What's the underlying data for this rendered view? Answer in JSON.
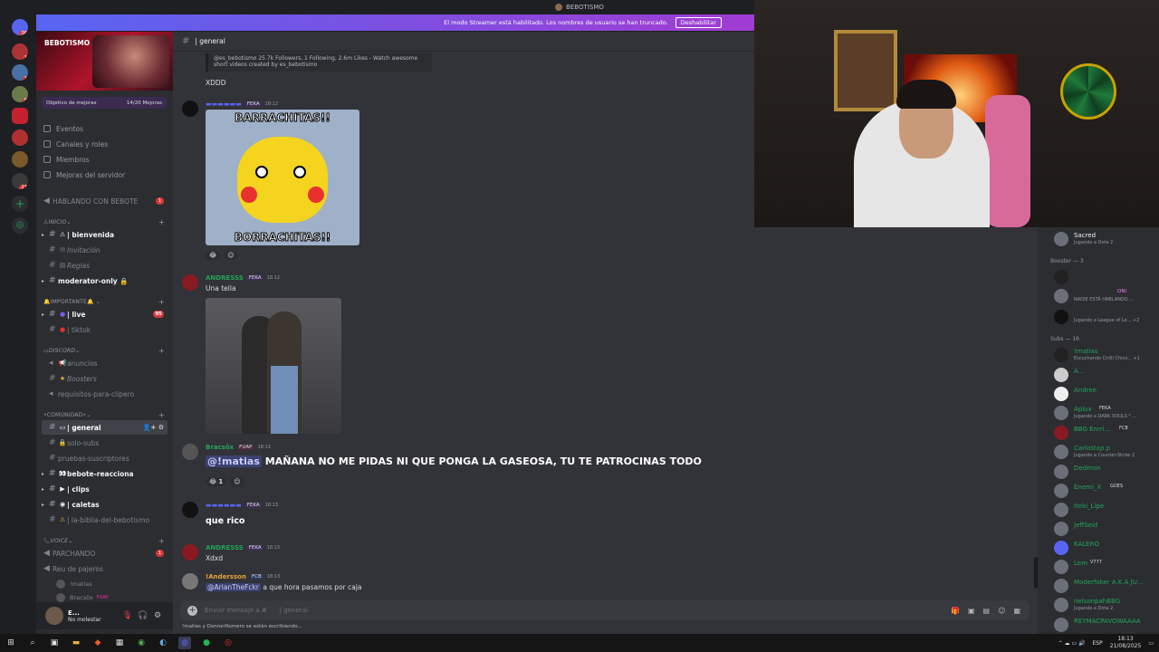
{
  "window": {
    "title": "BEBOTISMO"
  },
  "streamer_banner": {
    "text": "El modo Streamer está habilitado. Los nombres de usuario se han truncado.",
    "button": "Deshabilitar"
  },
  "guilds": {
    "badges": [
      "365",
      "13",
      "10",
      "97",
      "6",
      "214"
    ]
  },
  "server": {
    "name": "BEBOTISMO",
    "boost_label": "Objetivo de mejoras",
    "boost_count": "14/20 Mejoras",
    "nav": [
      "Eventos",
      "Canales y roles",
      "Miembros",
      "Mejoras del servidor"
    ],
    "hablando": {
      "label": "HABLANDO CON BEBOTE",
      "badge": "1"
    },
    "categories": {
      "inicio": "INICIO",
      "importante": "IMPORTANTE",
      "discord": "DISCORD",
      "comunidad": "•COMUNIDAD•",
      "voice": "VOICE"
    },
    "channels": [
      {
        "emoji": "⚠",
        "name": "| bienvenida"
      },
      {
        "emoji": "✉",
        "name": "Invitación"
      },
      {
        "emoji": "▤",
        "name": "Reglas"
      },
      {
        "emoji": "",
        "name": "moderator-only 🔒"
      },
      {
        "emoji": "●",
        "name": "| live",
        "badge": "95"
      },
      {
        "emoji": "●",
        "name": "| tiktok"
      },
      {
        "emoji": "📢",
        "name": "anuncios"
      },
      {
        "emoji": "★",
        "name": "Boosters"
      },
      {
        "emoji": "",
        "name": "requisitos-para-clipero"
      },
      {
        "emoji": "▭",
        "name": "| general"
      },
      {
        "emoji": "🔒",
        "name": "solo-subs"
      },
      {
        "emoji": "",
        "name": "pruebas-suscriptores"
      },
      {
        "emoji": "👀",
        "name": "bebote-reacciona"
      },
      {
        "emoji": "▶",
        "name": "| clips"
      },
      {
        "emoji": "◉",
        "name": "| caletas"
      },
      {
        "emoji": "⚠",
        "name": "| la-biblia-del-bebotismo"
      },
      {
        "emoji": "",
        "name": "PARCHANDO",
        "badge": "1"
      },
      {
        "emoji": "",
        "name": "Reu de pajeros"
      }
    ],
    "voice_users": [
      "!matias",
      "Bracsôx"
    ],
    "voice_user_tag": "FUAP"
  },
  "user": {
    "name": "E...",
    "status": "No molestar"
  },
  "channel": {
    "title": "| general",
    "input_placeholder": "Enviar mensaje a #",
    "input_channel": "| general",
    "typing": "!matias y DonnerRomero se están escribiendo..."
  },
  "messages": {
    "embed": "@es_bebotismo 25.7k Followers, 1 Following, 2.6m Likes - Watch awesome short videos created by es_bebotismo",
    "m0": {
      "text": "XDDD"
    },
    "m1": {
      "tag": "FEKA",
      "time": "18:12",
      "meme_top": "BARRACHITAS!!",
      "meme_bottom": "BORRACHITAS!!"
    },
    "m2": {
      "author": "ANDRESSS",
      "tag": "FEKA",
      "time": "18:12",
      "text": "Una tella"
    },
    "m3": {
      "author": "Bracsôx",
      "tag": "FUAP",
      "time": "18:13",
      "mention": "@!matias",
      "text": "MAÑANA NO ME PIDAS NI QUE PONGA LA GASEOSA, TU TE PATROCINAS TODO",
      "react_count": "1"
    },
    "m4": {
      "tag": "FEKA",
      "time": "18:13",
      "text": "que rico"
    },
    "m5": {
      "author": "ANDRESSS",
      "tag": "FEKA",
      "time": "18:13",
      "text": "Xdxd"
    },
    "m6": {
      "author": "!Andersson",
      "tag": "FCB",
      "time": "18:13",
      "mention": "@ArianTheFckr",
      "text": "a que hora pasamos por caja"
    }
  },
  "members": {
    "top": {
      "name": "Sacred",
      "status": "Jugando a Dota 2"
    },
    "booster_header": "Booster — 3",
    "boosters": [
      {
        "name": "",
        "status": ""
      },
      {
        "name": "",
        "tag": "ONI",
        "status": "NADIE ESTÁ HABLANDO ..."
      },
      {
        "name": "",
        "status": "Jugando a League of Le... +2"
      }
    ],
    "subs_header": "Subs — 16",
    "subs": [
      {
        "name": "!matias",
        "status": "Escuchando Chilli Chico... +1"
      },
      {
        "name": "A...",
        "status": ""
      },
      {
        "name": "Andree",
        "status": ""
      },
      {
        "name": "Aplux",
        "tag": "FEKA",
        "status": "Jugando a DARK SOULS™..."
      },
      {
        "name": "BBG Enrri...",
        "tag": "FCB",
        "status": ""
      },
      {
        "name": "Carlostap.p",
        "status": "Jugando a Counter-Strike 2"
      },
      {
        "name": "Dedmon",
        "status": ""
      },
      {
        "name": "Enemi_X",
        "tag": "GOES",
        "status": ""
      },
      {
        "name": "Iteki_Lipe",
        "status": ""
      },
      {
        "name": "JeffSeid",
        "status": ""
      },
      {
        "name": "KALERO",
        "status": ""
      },
      {
        "name": "Lem",
        "tag": "V777",
        "status": ""
      },
      {
        "name": "Moderfoker A.K.A JU...",
        "status": ""
      },
      {
        "name": "nelsonpahBBG",
        "status": "Jugando a Dota 2"
      },
      {
        "name": "REYMACPAVOWAAAA",
        "status": ""
      }
    ]
  },
  "taskbar": {
    "lang": "ESP",
    "time": "18:13",
    "date": "21/08/2025"
  },
  "colors": {
    "accent": "#5865f2",
    "green_name": "#23a55a",
    "bg_main": "#313338",
    "bg_sidebar": "#2b2d31"
  }
}
